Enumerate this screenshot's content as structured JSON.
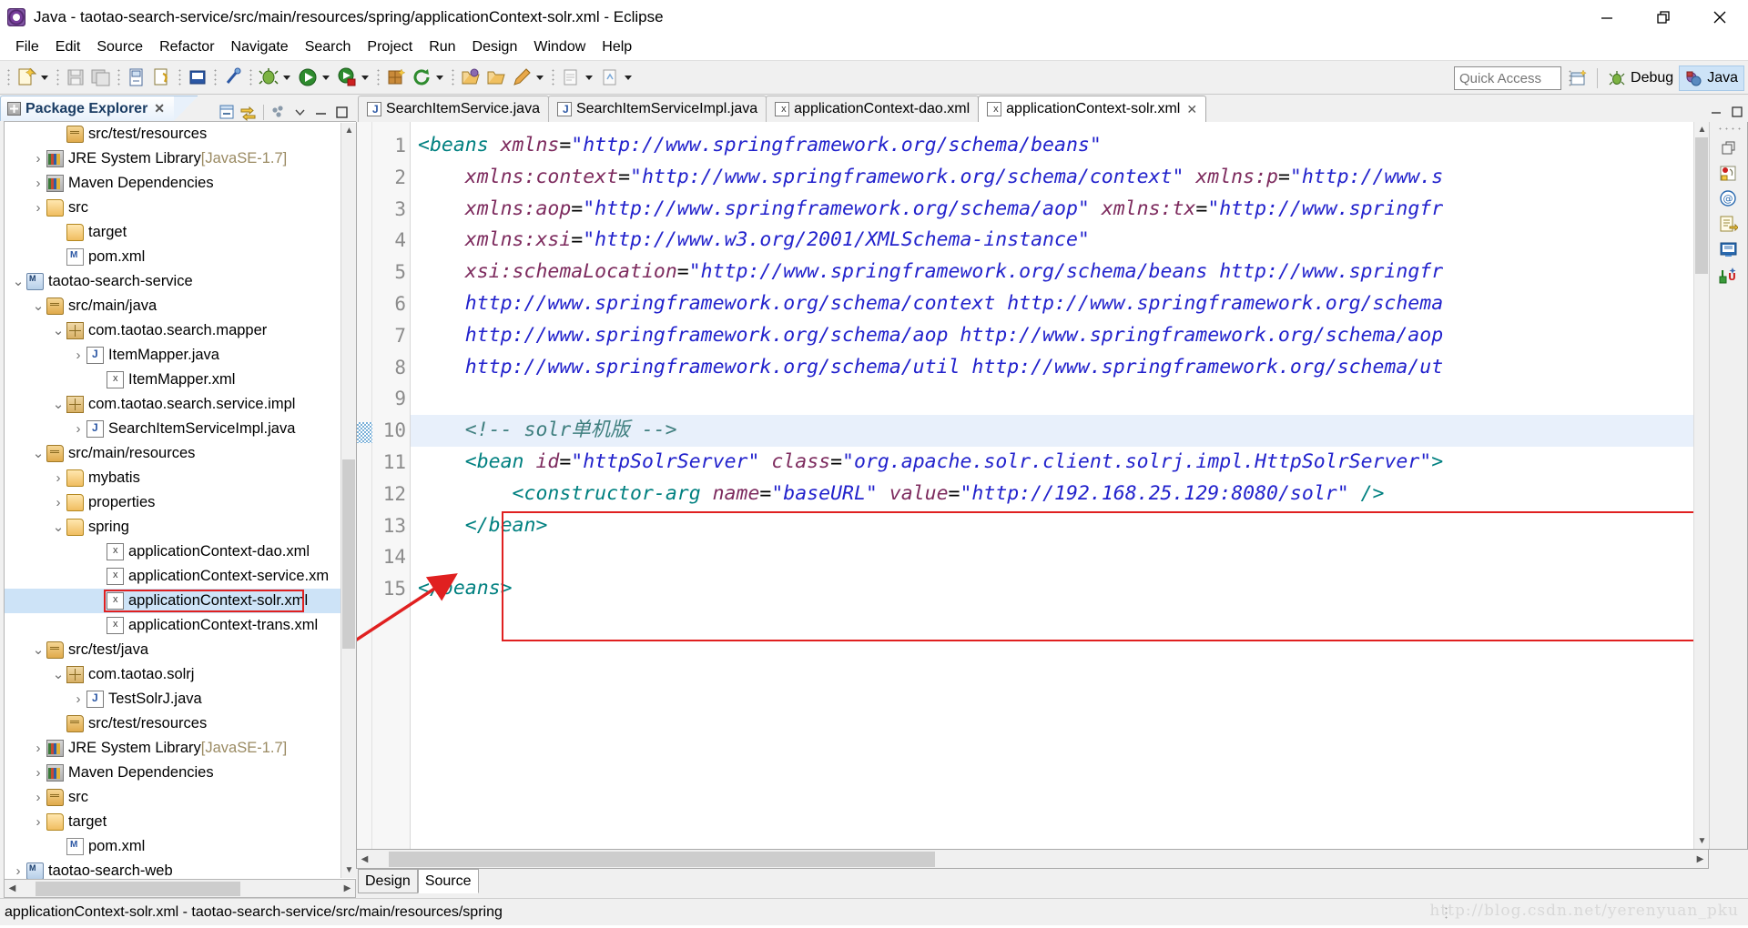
{
  "window": {
    "title": "Java - taotao-search-service/src/main/resources/spring/applicationContext-solr.xml - Eclipse",
    "app_icon": "eclipse-icon",
    "controls": {
      "minimize": "minimize-icon",
      "restore": "restore-icon",
      "close": "close-icon"
    }
  },
  "menubar": {
    "items": [
      "File",
      "Edit",
      "Source",
      "Refactor",
      "Navigate",
      "Search",
      "Project",
      "Run",
      "Design",
      "Window",
      "Help"
    ]
  },
  "toolbar": {
    "quick_access_placeholder": "Quick Access",
    "quick_access_value": "",
    "icons": [
      "new-wizard-icon",
      "save-icon",
      "save-all-icon",
      "print-icon",
      "link-icon",
      "new-java-class-icon",
      "debug-icon",
      "run-icon",
      "run-coverage-icon",
      "new-package-icon",
      "refresh-icon",
      "open-type-icon",
      "open-task-icon",
      "edit-icon",
      "toggle-mark-icon",
      "next-annotation-icon"
    ],
    "perspectives": [
      {
        "label": "Debug",
        "icon": "debug-perspective-icon",
        "active": false
      },
      {
        "label": "Java",
        "icon": "java-perspective-icon",
        "active": true
      }
    ],
    "open_perspective_icon": "open-perspective-icon"
  },
  "explorer": {
    "title": "Package Explorer",
    "close_glyph": "✕",
    "view_icons": [
      "collapse-all-icon",
      "link-with-editor-icon",
      "view-menu-icon",
      "minimize-view-icon",
      "maximize-view-icon"
    ],
    "tree": [
      {
        "label": "src/test/resources",
        "icon": "source-folder-icon",
        "indent": 2,
        "twisty": "none"
      },
      {
        "label": "JRE System Library ",
        "suffix": "[JavaSE-1.7]",
        "icon": "library-icon",
        "indent": 1,
        "twisty": "collapsed"
      },
      {
        "label": "Maven Dependencies",
        "icon": "library-icon",
        "indent": 1,
        "twisty": "collapsed"
      },
      {
        "label": "src",
        "icon": "folder-icon",
        "indent": 1,
        "twisty": "collapsed"
      },
      {
        "label": "target",
        "icon": "folder-icon",
        "indent": 2,
        "twisty": "none"
      },
      {
        "label": "pom.xml",
        "icon": "pom-icon",
        "indent": 2,
        "twisty": "none"
      },
      {
        "label": "taotao-search-service",
        "icon": "maven-project-icon",
        "indent": 0,
        "twisty": "expanded"
      },
      {
        "label": "src/main/java",
        "icon": "source-folder-icon",
        "indent": 1,
        "twisty": "expanded"
      },
      {
        "label": "com.taotao.search.mapper",
        "icon": "package-icon",
        "indent": 2,
        "twisty": "expanded"
      },
      {
        "label": "ItemMapper.java",
        "icon": "java-file-icon",
        "indent": 3,
        "twisty": "collapsed"
      },
      {
        "label": "ItemMapper.xml",
        "icon": "xml-file-icon",
        "indent": 4,
        "twisty": "none"
      },
      {
        "label": "com.taotao.search.service.impl",
        "icon": "package-icon",
        "indent": 2,
        "twisty": "expanded"
      },
      {
        "label": "SearchItemServiceImpl.java",
        "icon": "java-file-icon",
        "indent": 3,
        "twisty": "collapsed"
      },
      {
        "label": "src/main/resources",
        "icon": "source-folder-icon",
        "indent": 1,
        "twisty": "expanded"
      },
      {
        "label": "mybatis",
        "icon": "folder-icon",
        "indent": 2,
        "twisty": "collapsed"
      },
      {
        "label": "properties",
        "icon": "folder-icon",
        "indent": 2,
        "twisty": "collapsed"
      },
      {
        "label": "spring",
        "icon": "folder-icon",
        "indent": 2,
        "twisty": "expanded"
      },
      {
        "label": "applicationContext-dao.xml",
        "icon": "xml-file-icon",
        "indent": 4,
        "twisty": "none"
      },
      {
        "label": "applicationContext-service.xm",
        "icon": "xml-file-icon",
        "indent": 4,
        "twisty": "none"
      },
      {
        "label": "applicationContext-solr.xml",
        "icon": "xml-file-icon",
        "indent": 4,
        "twisty": "none",
        "selected": true,
        "highlighted": true
      },
      {
        "label": "applicationContext-trans.xml",
        "icon": "xml-file-icon",
        "indent": 4,
        "twisty": "none"
      },
      {
        "label": "src/test/java",
        "icon": "source-folder-icon",
        "indent": 1,
        "twisty": "expanded"
      },
      {
        "label": "com.taotao.solrj",
        "icon": "package-icon",
        "indent": 2,
        "twisty": "expanded"
      },
      {
        "label": "TestSolrJ.java",
        "icon": "java-file-icon",
        "indent": 3,
        "twisty": "collapsed"
      },
      {
        "label": "src/test/resources",
        "icon": "source-folder-icon",
        "indent": 2,
        "twisty": "none"
      },
      {
        "label": "JRE System Library ",
        "suffix": "[JavaSE-1.7]",
        "icon": "library-icon",
        "indent": 1,
        "twisty": "collapsed"
      },
      {
        "label": "Maven Dependencies",
        "icon": "library-icon",
        "indent": 1,
        "twisty": "collapsed"
      },
      {
        "label": "src",
        "icon": "source-folder-icon",
        "indent": 1,
        "twisty": "collapsed"
      },
      {
        "label": "target",
        "icon": "folder-icon",
        "indent": 1,
        "twisty": "collapsed"
      },
      {
        "label": "pom.xml",
        "icon": "pom-icon",
        "indent": 2,
        "twisty": "none"
      },
      {
        "label": "taotao-search-web",
        "icon": "maven-project-icon",
        "indent": 0,
        "twisty": "collapsed"
      }
    ]
  },
  "editor": {
    "tabs": [
      {
        "label": "SearchItemService.java",
        "icon": "java-file-icon",
        "active": false,
        "closeable": false
      },
      {
        "label": "SearchItemServiceImpl.java",
        "icon": "java-file-icon",
        "active": false,
        "closeable": false
      },
      {
        "label": "applicationContext-dao.xml",
        "icon": "xml-file-icon",
        "active": false,
        "closeable": false
      },
      {
        "label": "applicationContext-solr.xml",
        "icon": "xml-file-icon",
        "active": true,
        "closeable": true,
        "close_glyph": "✕"
      }
    ],
    "tab_tools": [
      "minimize-editor-icon",
      "maximize-editor-icon"
    ],
    "line_numbers": [
      "1",
      "2",
      "3",
      "4",
      "5",
      "6",
      "7",
      "8",
      "9",
      "10",
      "11",
      "12",
      "13",
      "14",
      "15"
    ],
    "code_lines": [
      {
        "n": 1,
        "fold": true,
        "tokens": [
          {
            "t": "tag",
            "v": "<beans "
          },
          {
            "t": "attr",
            "v": "xmlns"
          },
          {
            "t": "eq",
            "v": "="
          },
          {
            "t": "val",
            "v": "\"http://www.springframework.org/schema/beans\""
          }
        ]
      },
      {
        "n": 2,
        "tokens": [
          {
            "t": "plain",
            "v": "    "
          },
          {
            "t": "attr",
            "v": "xmlns:context"
          },
          {
            "t": "eq",
            "v": "="
          },
          {
            "t": "val",
            "v": "\"http://www.springframework.org/schema/context\""
          },
          {
            "t": "plain",
            "v": " "
          },
          {
            "t": "attr",
            "v": "xmlns:p"
          },
          {
            "t": "eq",
            "v": "="
          },
          {
            "t": "val",
            "v": "\"http://www.s"
          }
        ]
      },
      {
        "n": 3,
        "tokens": [
          {
            "t": "plain",
            "v": "    "
          },
          {
            "t": "attr",
            "v": "xmlns:aop"
          },
          {
            "t": "eq",
            "v": "="
          },
          {
            "t": "val",
            "v": "\"http://www.springframework.org/schema/aop\""
          },
          {
            "t": "plain",
            "v": " "
          },
          {
            "t": "attr",
            "v": "xmlns:tx"
          },
          {
            "t": "eq",
            "v": "="
          },
          {
            "t": "val",
            "v": "\"http://www.springfr"
          }
        ]
      },
      {
        "n": 4,
        "tokens": [
          {
            "t": "plain",
            "v": "    "
          },
          {
            "t": "attr",
            "v": "xmlns:xsi"
          },
          {
            "t": "eq",
            "v": "="
          },
          {
            "t": "val",
            "v": "\"http://www.w3.org/2001/XMLSchema-instance\""
          }
        ]
      },
      {
        "n": 5,
        "tokens": [
          {
            "t": "plain",
            "v": "    "
          },
          {
            "t": "attr",
            "v": "xsi:schemaLocation"
          },
          {
            "t": "eq",
            "v": "="
          },
          {
            "t": "val",
            "v": "\"http://www.springframework.org/schema/beans http://www.springfr"
          }
        ]
      },
      {
        "n": 6,
        "tokens": [
          {
            "t": "val",
            "v": "    http://www.springframework.org/schema/context http://www.springframework.org/schema"
          }
        ]
      },
      {
        "n": 7,
        "tokens": [
          {
            "t": "val",
            "v": "    http://www.springframework.org/schema/aop http://www.springframework.org/schema/aop"
          }
        ]
      },
      {
        "n": 8,
        "tokens": [
          {
            "t": "val",
            "v": "    http://www.springframework.org/schema/util http://www.springframework.org/schema/ut"
          }
        ]
      },
      {
        "n": 9,
        "tokens": []
      },
      {
        "n": 10,
        "highlight": true,
        "tokens": [
          {
            "t": "cmt",
            "v": "    <!-- solr单机版 -->"
          }
        ]
      },
      {
        "n": 11,
        "fold": true,
        "tokens": [
          {
            "t": "tag",
            "v": "    <bean "
          },
          {
            "t": "attr",
            "v": "id"
          },
          {
            "t": "eq",
            "v": "="
          },
          {
            "t": "val",
            "v": "\"httpSolrServer\""
          },
          {
            "t": "plain",
            "v": " "
          },
          {
            "t": "attr",
            "v": "class"
          },
          {
            "t": "eq",
            "v": "="
          },
          {
            "t": "val",
            "v": "\"org.apache.solr.client.solrj.impl.HttpSolrServer\""
          },
          {
            "t": "tag",
            "v": ">"
          }
        ]
      },
      {
        "n": 12,
        "tokens": [
          {
            "t": "tag",
            "v": "        <constructor-arg "
          },
          {
            "t": "attr",
            "v": "name"
          },
          {
            "t": "eq",
            "v": "="
          },
          {
            "t": "val",
            "v": "\"baseURL\""
          },
          {
            "t": "plain",
            "v": " "
          },
          {
            "t": "attr",
            "v": "value"
          },
          {
            "t": "eq",
            "v": "="
          },
          {
            "t": "val",
            "v": "\"http://192.168.25.129:8080/solr\""
          },
          {
            "t": "plain",
            "v": " "
          },
          {
            "t": "tag",
            "v": "/>"
          }
        ]
      },
      {
        "n": 13,
        "tokens": [
          {
            "t": "tag",
            "v": "    </bean>"
          }
        ]
      },
      {
        "n": 14,
        "tokens": []
      },
      {
        "n": 15,
        "tokens": [
          {
            "t": "tag",
            "v": "</beans>"
          }
        ]
      }
    ],
    "bottom_tabs": [
      {
        "label": "Design",
        "active": false
      },
      {
        "label": "Source",
        "active": true
      }
    ],
    "right_bar_icons": [
      "restore-view-icon",
      "breakpoints-icon",
      "email-icon",
      "outline-icon",
      "console-icon",
      "junit-icon"
    ],
    "annotation": {
      "red_box_code": "red-highlight-box",
      "red_box_tree": "red-highlight-box",
      "arrow": "red-arrow-annotation"
    }
  },
  "statusbar": {
    "text": "applicationContext-solr.xml - taotao-search-service/src/main/resources/spring",
    "watermark": "http://blog.csdn.net/yerenyuan_pku"
  },
  "colors": {
    "accent_selection": "#cde3f7",
    "annotation_red": "#e02020",
    "xml_tag": "#008080",
    "xml_attr": "#7d2b5e",
    "xml_value": "#2222cc",
    "xml_comment": "#3f7f7f",
    "toolbar_bg": "#f0f0f0",
    "line_highlight": "#e8f0fb"
  }
}
